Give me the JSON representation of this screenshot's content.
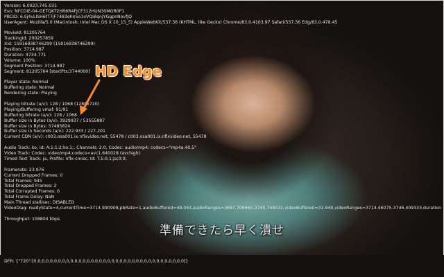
{
  "stats": {
    "version": "Version: 6.0023.745.031",
    "esn": "Esn: NFCDIE-04-GETQKT2HR6R4FJCF312HUN30MGR0P1",
    "pbcid": "PBCID: 6.Sj4vLISH6tT7jF7483ehn5o1oVQiBqnjYGgpnNovfJQ",
    "user_agent": "UserAgent: Mozilla/5.0 (Macintosh; Intel Mac OS X 10_15_5) AppleWebKit/537.36 (KHTML, like Gecko) Chrome/83.0.4103.97 Safari/537.36 Edg/83.0.478.45",
    "movie_id": "MovieId: 81205764",
    "tracking_id": "TrackingId: 200257859",
    "xid": "Xid: 15916938746299 (15916938746299)",
    "position": "Position: 3714.987",
    "duration": "Duration: 4734.771",
    "volume": "Volume: 100%",
    "segment_position": "Segment Position: 3714.987",
    "segment": "Segment: 81205764 [startPts:3744000]",
    "player_state": "Player state: Normal",
    "buffering_state": "Buffering state: Normal",
    "rendering_state": "Rendering state: Playing",
    "playing_bitrate": "Playing bitrate (a/v): 128 / 1068 (1280x720)",
    "playing_buffering_vmaf": "Playing/Buffering vmaf: 91/91",
    "buffering_bitrate": "Buffering bitrate (a/v): 128 / 1068",
    "buffer_bytes_av": "Buffer size in Bytes (a/v): 3929937 / 53555887",
    "buffer_bytes": "Buffer size in Bytes: 57485824",
    "buffer_seconds": "Buffer size in Seconds (a/v): 222.933 / 227.201",
    "current_cdn": "Current CDN (a/v): c003.osa001.ix.nflxvideo.net, 55478 / c003.osa001.ix.nflxvideo.net, 55478",
    "audio_track": "Audio Track: ko, Id: A:1:1:2;ko:1;, Channels: 2.0, Codec: audio/mp4; codecs=\"mp4a.40.5\"",
    "video_track": "Video Track: Codec: video/mp4;codecs=avc1.640028 (avchigh)",
    "timed_text_track": "Timed Text Track: ja, Profile: nflx-cmisc, Id: T:1:0;1;ja;0;0;",
    "framerate": "Framerate: 23.976",
    "current_dropped": "Current Dropped Frames: 0",
    "total_frames": "Total Frames: 945",
    "total_dropped": "Total Dropped Frames: 2",
    "total_corrupted": "Total Corrupted Frames: 0",
    "total_frame_delay": "Total Frame Delay: NaN",
    "main_thread_stall": "Main Thread stall/sec: DISABLED",
    "video_diag": "VideoDiag: readyState=4,currentTime=3714.990908,pbRate=1,audioBuffered=48.043,audioRanges=3697.706665-3745.749332,videoBuffered=31.949,videoRanges=3714.46075-3746.409333,duration=4734.7717",
    "throughput": "Throughput: 108804 kbps",
    "dfr": "DFR: {\"720\":[0,0,0,0,0,0,0,0,0,0,0,0,0,0,0,0,0,0,0,0,0,0,0,0,0,0,0,0,0,0,0,0,0,0,0,0,0]}"
  },
  "annotation": {
    "callout_text": "HD Edge",
    "callout_color": "#ff8a1f"
  },
  "subtitle": {
    "text": "準備できたら早く潰せ"
  }
}
